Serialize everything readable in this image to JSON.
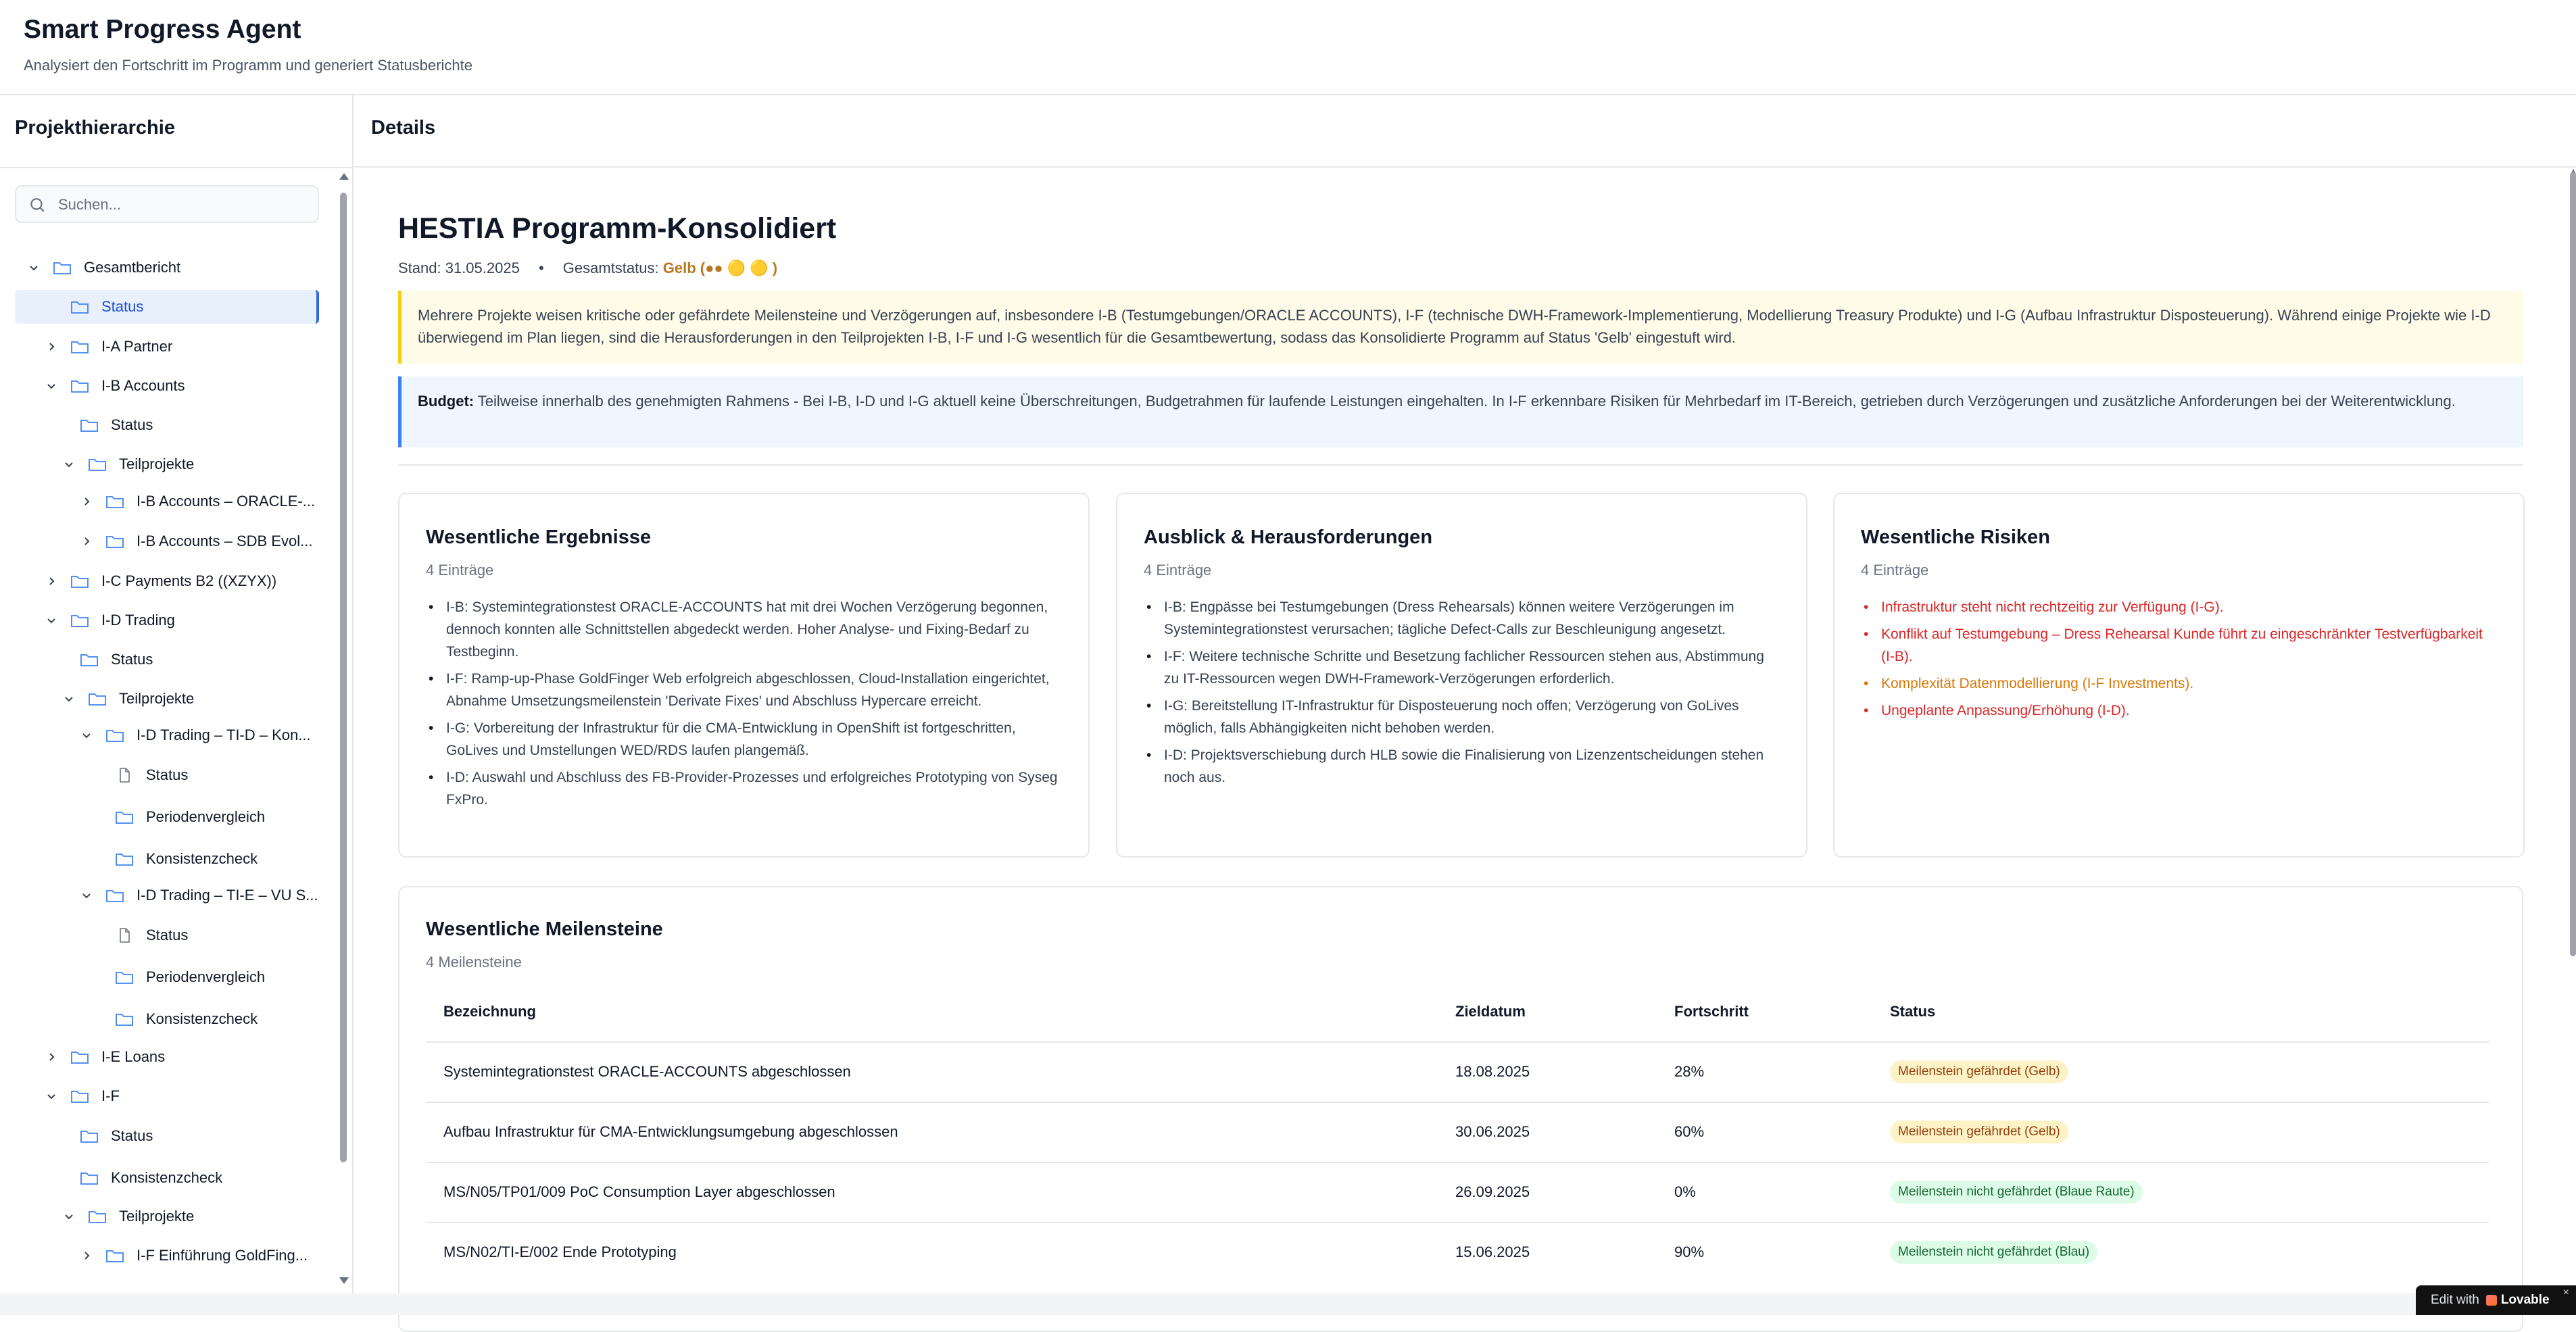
{
  "app": {
    "title": "Smart Progress Agent",
    "subtitle": "Analysiert den Fortschritt im Programm und generiert Statusberichte"
  },
  "sidebar": {
    "title": "Projekthierarchie",
    "search_placeholder": "Suchen...",
    "tree": [
      {
        "label": "Gesamtbericht",
        "expanded": true,
        "icon": "folder-icon"
      },
      {
        "label": "Status",
        "selected": true,
        "icon": "folder-icon"
      },
      {
        "label": "I-A Partner",
        "expanded": false,
        "icon": "folder-icon"
      },
      {
        "label": "I-B Accounts",
        "expanded": true,
        "icon": "folder-icon"
      },
      {
        "label": "Status",
        "icon": "folder-icon"
      },
      {
        "label": "Teilprojekte",
        "expanded": true,
        "icon": "folder-icon"
      },
      {
        "label": "I-B Accounts – ORACLE-...",
        "expanded": false,
        "icon": "folder-icon"
      },
      {
        "label": "I-B Accounts – SDB Evol...",
        "expanded": false,
        "icon": "folder-icon"
      },
      {
        "label": "I-C Payments B2 ((XZYX))",
        "expanded": false,
        "icon": "folder-icon"
      },
      {
        "label": "I-D Trading",
        "expanded": true,
        "icon": "folder-icon"
      },
      {
        "label": "Status",
        "icon": "folder-icon"
      },
      {
        "label": "Teilprojekte",
        "expanded": true,
        "icon": "folder-icon"
      },
      {
        "label": "I-D Trading – TI-D – Kon...",
        "expanded": true,
        "icon": "folder-icon"
      },
      {
        "label": "Status",
        "icon": "file-icon"
      },
      {
        "label": "Periodenvergleich",
        "icon": "folder-icon"
      },
      {
        "label": "Konsistenzcheck",
        "icon": "folder-icon"
      },
      {
        "label": "I-D Trading – TI-E – VU S...",
        "expanded": true,
        "icon": "folder-icon"
      },
      {
        "label": "Status",
        "icon": "file-icon"
      },
      {
        "label": "Periodenvergleich",
        "icon": "folder-icon"
      },
      {
        "label": "Konsistenzcheck",
        "icon": "folder-icon"
      },
      {
        "label": "I-E Loans",
        "expanded": false,
        "icon": "folder-icon"
      },
      {
        "label": "I-F",
        "expanded": true,
        "icon": "folder-icon"
      },
      {
        "label": "Status",
        "icon": "folder-icon"
      },
      {
        "label": "Konsistenzcheck",
        "icon": "folder-icon"
      },
      {
        "label": "Teilprojekte",
        "expanded": true,
        "icon": "folder-icon"
      },
      {
        "label": "I-F Einführung GoldFing...",
        "expanded": false,
        "icon": "folder-icon"
      }
    ]
  },
  "main": {
    "header": "Details",
    "program_title": "HESTIA Programm-Konsolidiert",
    "stand": "Stand: 31.05.2025",
    "separator": "•",
    "gesamtstatus_label": "Gesamtstatus:",
    "gesamtstatus_value": "Gelb (●● 🟡 🟡 )",
    "summary": "Mehrere Projekte weisen kritische oder gefährdete Meilensteine und Verzögerungen auf, insbesondere I-B (Testumgebungen/ORACLE ACCOUNTS), I-F (technische DWH-Framework-Implementierung, Modellierung Treasury Produkte) und I-G (Aufbau Infrastruktur Disposteuerung). Während einige Projekte wie I-D überwiegend im Plan liegen, sind die Herausforderungen in den Teilprojekten I-B, I-F und I-G wesentlich für die Gesamtbewertung, sodass das Konsolidierte Programm auf Status 'Gelb' eingestuft wird.",
    "budget_label": "Budget:",
    "budget_text": " Teilweise innerhalb des genehmigten Rahmens - Bei I-B, I-D und I-G aktuell keine Überschreitungen, Budgetrahmen für laufende Leistungen eingehalten. In I-F erkennbare Risiken für Mehrbedarf im IT-Bereich, getrieben durch Verzögerungen und zusätzliche Anforderungen bei der Weiterentwicklung.",
    "cards": {
      "results": {
        "title": "Wesentliche Ergebnisse",
        "count": "4 Einträge",
        "items": [
          "I-B: Systemintegrationstest ORACLE-ACCOUNTS hat mit drei Wochen Verzögerung begonnen, dennoch konnten alle Schnittstellen abgedeckt werden. Hoher Analyse- und Fixing-Bedarf zu Testbeginn.",
          "I-F: Ramp-up-Phase GoldFinger Web erfolgreich abgeschlossen, Cloud-Installation eingerichtet, Abnahme Umsetzungsmeilenstein 'Derivate Fixes' und Abschluss Hypercare erreicht.",
          "I-G: Vorbereitung der Infrastruktur für die CMA-Entwicklung in OpenShift ist fortgeschritten, GoLives und Umstellungen WED/RDS laufen plangemäß.",
          "I-D: Auswahl und Abschluss des FB-Provider-Prozesses und erfolgreiches Prototyping von Syseg FxPro."
        ]
      },
      "outlook": {
        "title": "Ausblick & Herausforderungen",
        "count": "4 Einträge",
        "items": [
          "I-B: Engpässe bei Testumgebungen (Dress Rehearsals) können weitere Verzögerungen im Systemintegrationstest verursachen; tägliche Defect-Calls zur Beschleunigung angesetzt.",
          "I-F: Weitere technische Schritte und Besetzung fachlicher Ressourcen stehen aus, Abstimmung zu IT-Ressourcen wegen DWH-Framework-Verzögerungen erforderlich.",
          "I-G: Bereitstellung IT-Infrastruktur für Disposteuerung noch offen; Verzögerung von GoLives möglich, falls Abhängigkeiten nicht behoben werden.",
          "I-D: Projektsverschiebung durch HLB sowie die Finalisierung von Lizenzentscheidungen stehen noch aus."
        ]
      },
      "risks": {
        "title": "Wesentliche Risiken",
        "count": "4 Einträge",
        "items": [
          {
            "text": "Infrastruktur steht nicht rechtzeitig zur Verfügung (I-G).",
            "level": "red"
          },
          {
            "text": "Konflikt auf Testumgebung – Dress Rehearsal Kunde führt zu eingeschränkter Testverfügbarkeit (I-B).",
            "level": "red"
          },
          {
            "text": "Komplexität Datenmodellierung (I-F Investments).",
            "level": "amber"
          },
          {
            "text": "Ungeplante Anpassung/Erhöhung (I-D).",
            "level": "red"
          }
        ]
      }
    },
    "milestones": {
      "title": "Wesentliche Meilensteine",
      "count": "4 Meilensteine",
      "columns": [
        "Bezeichnung",
        "Zieldatum",
        "Fortschritt",
        "Status"
      ],
      "rows": [
        {
          "name": "Systemintegrationstest ORACLE-ACCOUNTS abgeschlossen",
          "date": "18.08.2025",
          "progress": "28%",
          "status": "Meilenstein gefährdet (Gelb)",
          "color": "yellow"
        },
        {
          "name": "Aufbau Infrastruktur für CMA-Entwicklungsumgebung abgeschlossen",
          "date": "30.06.2025",
          "progress": "60%",
          "status": "Meilenstein gefährdet (Gelb)",
          "color": "yellow"
        },
        {
          "name": "MS/N05/TP01/009 PoC Consumption Layer abgeschlossen",
          "date": "26.09.2025",
          "progress": "0%",
          "status": "Meilenstein nicht gefährdet (Blaue Raute)",
          "color": "green"
        },
        {
          "name": "MS/N02/TI-E/002 Ende Prototyping",
          "date": "15.06.2025",
          "progress": "90%",
          "status": "Meilenstein nicht gefährdet (Blau)",
          "color": "green"
        }
      ]
    }
  },
  "footer": {
    "edit_with": "Edit with",
    "brand": "Lovable",
    "close": "×"
  }
}
